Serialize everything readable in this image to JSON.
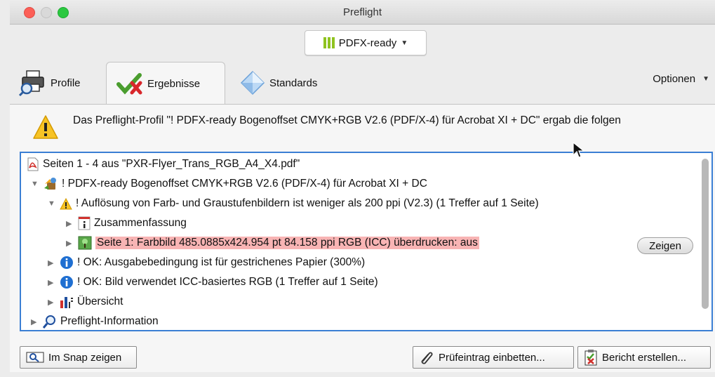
{
  "window": {
    "title": "Preflight"
  },
  "profile_selector": {
    "label": "PDFX-ready"
  },
  "tabs": [
    {
      "label": "Profile"
    },
    {
      "label": "Ergebnisse"
    },
    {
      "label": "Standards"
    }
  ],
  "options_menu": {
    "label": "Optionen"
  },
  "summary": {
    "text": "Das Preflight-Profil \"! PDFX-ready Bogenoffset CMYK+RGB V2.6 (PDF/X-4) für Acrobat XI + DC\" ergab die folgen"
  },
  "tree": {
    "rows": [
      {
        "label": "Seiten 1 - 4 aus \"PXR-Flyer_Trans_RGB_A4_X4.pdf\"",
        "icon": "pdf-icon"
      },
      {
        "label": "! PDFX-ready Bogenoffset CMYK+RGB V2.6 (PDF/X-4) für Acrobat XI + DC",
        "icon": "profile-icon"
      },
      {
        "label": "! Auflösung von Farb- und Graustufenbildern ist weniger als 200 ppi (V2.3) (1 Treffer auf 1 Seite)",
        "icon": "warning-icon"
      },
      {
        "label": "Zusammenfassung",
        "icon": "info-sheet-icon"
      },
      {
        "label": "Seite 1: Farbbild 485.0885x424.954 pt 84.158 ppi RGB (ICC) überdrucken: aus",
        "icon": "image-icon"
      },
      {
        "label": "! OK: Ausgabebedingung ist für gestrichenes Papier (300%)",
        "icon": "info-icon"
      },
      {
        "label": "! OK: Bild verwendet ICC-basiertes RGB (1 Treffer auf 1 Seite)",
        "icon": "info-icon"
      },
      {
        "label": "Übersicht",
        "icon": "chart-icon"
      },
      {
        "label": "Preflight-Information",
        "icon": "magnifier-icon"
      }
    ],
    "show_button": "Zeigen"
  },
  "buttons": {
    "snap": "Im Snap zeigen",
    "embed": "Prüfeintrag einbetten...",
    "report": "Bericht erstellen..."
  },
  "colors": {
    "selection_border": "#3b7fd4",
    "highlight_row": "#f8b4b4",
    "accent_green": "#8fc31f"
  }
}
